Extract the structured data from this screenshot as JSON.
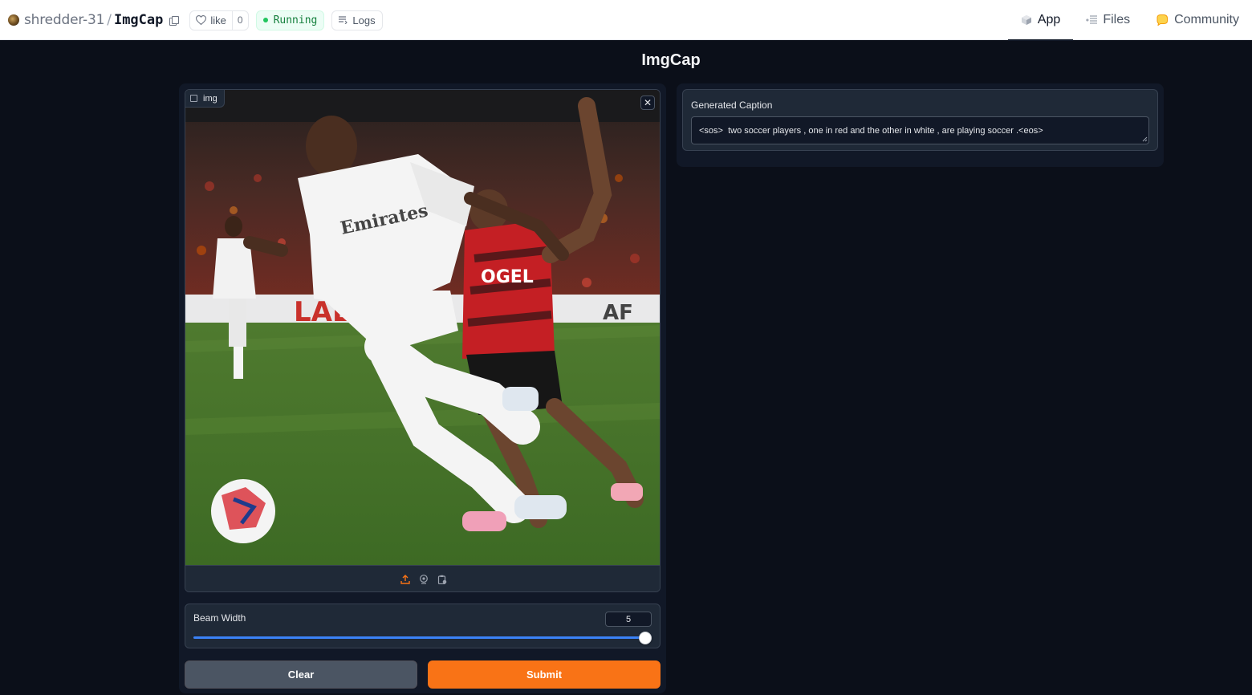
{
  "header": {
    "owner": "shredder-31",
    "separator": "/",
    "space_name": "ImgCap",
    "like_label": "like",
    "like_count": "0",
    "status": "Running",
    "logs_label": "Logs",
    "tabs": [
      {
        "label": "App",
        "icon": "cube-icon",
        "active": true
      },
      {
        "label": "Files",
        "icon": "files-icon",
        "active": false
      },
      {
        "label": "Community",
        "icon": "community-icon",
        "active": false
      }
    ]
  },
  "app": {
    "title": "ImgCap",
    "image_input": {
      "label": "img",
      "source_icons": [
        "upload-icon",
        "webcam-icon",
        "clipboard-icon"
      ]
    },
    "slider": {
      "label": "Beam Width",
      "value": "5",
      "fill_fraction": 1.0
    },
    "buttons": {
      "clear": "Clear",
      "submit": "Submit"
    },
    "output": {
      "label": "Generated Caption",
      "value": "<sos>  two soccer players , one in red and the other in white , are playing soccer .<eos>"
    }
  },
  "colors": {
    "background": "#0b0f19",
    "panel": "#111827",
    "submit": "#f97316",
    "slider": "#3b82f6",
    "status_green": "#22c55e"
  }
}
